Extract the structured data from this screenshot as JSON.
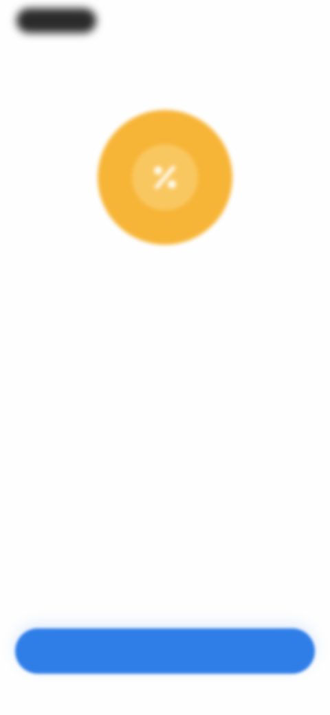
{
  "status_bar": {
    "pill_color": "#2b2b2b"
  },
  "hero": {
    "icon": "badge-percent-icon",
    "color": "#f7b537"
  },
  "content": {
    "title": "",
    "subtitle": ""
  },
  "primary_action": {
    "label": "",
    "color": "#2f7ee8"
  }
}
